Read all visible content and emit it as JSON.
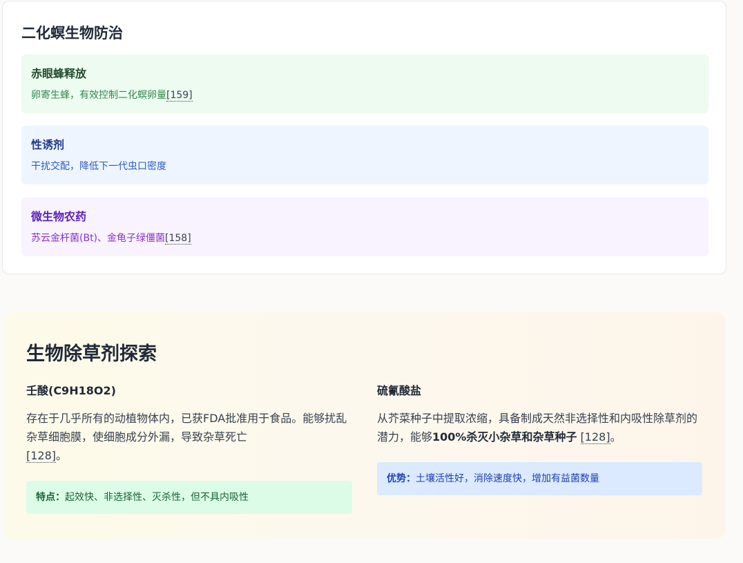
{
  "section1": {
    "title": "二化螟生物防治",
    "items": [
      {
        "title": "赤眼蜂释放",
        "desc": "卵寄生蜂，有效控制二化螟卵量",
        "ref": "[159]"
      },
      {
        "title": "性诱剂",
        "desc": "干扰交配，降低下一代虫口密度",
        "ref": ""
      },
      {
        "title": "微生物农药",
        "desc": "苏云金杆菌(Bt)、金龟子绿僵菌",
        "ref": "[158]"
      }
    ]
  },
  "section2": {
    "title": "生物除草剂探索",
    "left": {
      "title": "壬酸(C9H18O2)",
      "body": "存在于几乎所有的动植物体内，已获FDA批准用于食品。能够扰乱杂草细胞膜，使细胞成分外漏，导致杂草死亡",
      "ref": "[128]",
      "tail": "。",
      "note_label": "特点：",
      "note_text": "起效快、非选择性、灭杀性，但不具内吸性"
    },
    "right": {
      "title": "硫氰酸盐",
      "body": "从芥菜种子中提取浓缩，具备制成天然非选择性和内吸性除草剂的潜力，能够",
      "strong": "100%杀灭小杂草和杂草种子",
      "ref": "[128]",
      "tail": "。",
      "note_label": "优势：",
      "note_text": "土壤活性好，消除速度快，增加有益菌数量"
    }
  },
  "colors": {
    "green_bg": "#edfbf1",
    "blue_bg": "#eef5fe",
    "purple_bg": "#f8f3fe",
    "note_green": "#dcfce7",
    "note_blue": "#dbeafe"
  }
}
